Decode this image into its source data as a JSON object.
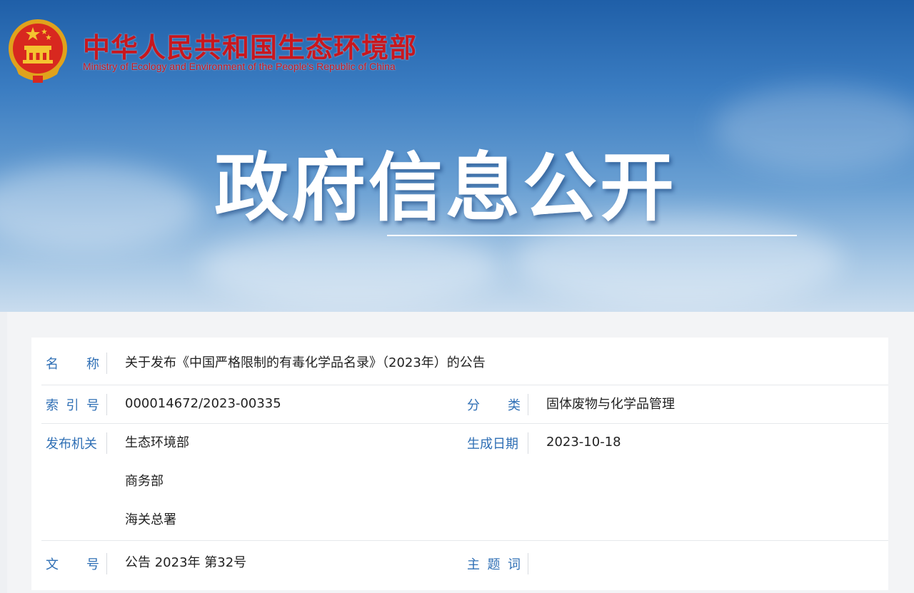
{
  "header": {
    "ministry_cn": "中华人民共和国生态环境部",
    "ministry_en": "Ministry of Ecology and Environment of the People's Republic of China",
    "banner_title": "政府信息公开"
  },
  "info": {
    "name_label": [
      "名",
      "称"
    ],
    "name_value": "关于发布《中国严格限制的有毒化学品名录》（2023年）的公告",
    "index_label": [
      "索",
      "引",
      "号"
    ],
    "index_value": "000014672/2023-00335",
    "category_label": [
      "分",
      "类"
    ],
    "category_value": "固体废物与化学品管理",
    "issuer_label": "发布机关",
    "issuers": [
      "生态环境部",
      "商务部",
      "海关总署"
    ],
    "date_label": "生成日期",
    "date_value": "2023-10-18",
    "doc_no_label": [
      "文",
      "号"
    ],
    "doc_no_value": "公告 2023年 第32号",
    "keywords_label": [
      "主",
      "题",
      "词"
    ],
    "keywords_value": ""
  },
  "colors": {
    "brand_red": "#c8171e",
    "label_blue": "#2f6fb5"
  }
}
